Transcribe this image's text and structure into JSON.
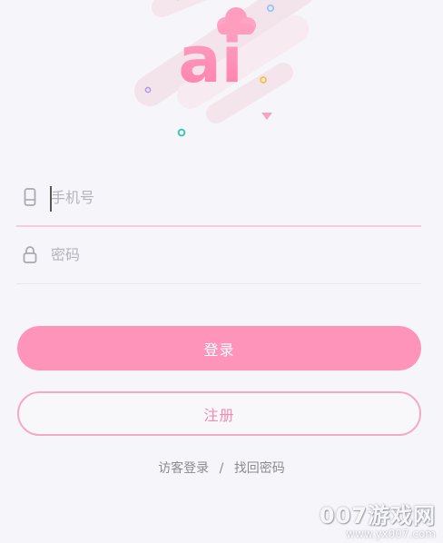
{
  "logo": {
    "text": "ai"
  },
  "login_form": {
    "phone_placeholder": "手机号",
    "password_placeholder": "密码",
    "login_label": "登录",
    "register_label": "注册"
  },
  "links": {
    "guest_login": "访客登录",
    "separator": "/",
    "recover_password": "找回密码"
  },
  "watermark": {
    "main": "007游戏网",
    "url": "www.yx007.com"
  },
  "colors": {
    "accent": "#ff94bb",
    "accent_border": "#f6a9c6",
    "background": "#f6f6fa"
  }
}
